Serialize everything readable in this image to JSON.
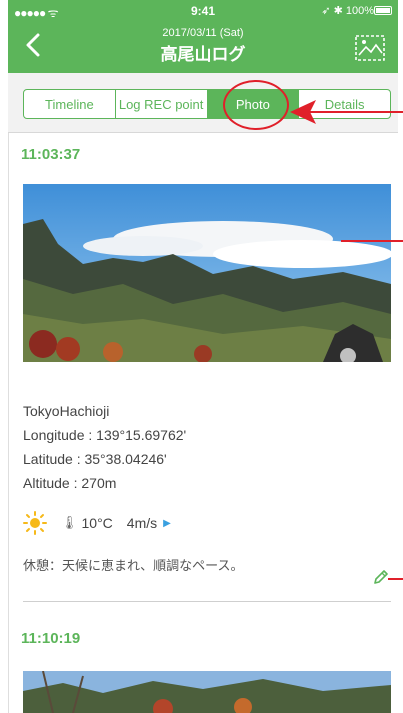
{
  "status_bar": {
    "signal": "●●●●● ᯤ",
    "time": "9:41",
    "right": "➶ ✱ 100%"
  },
  "nav": {
    "date": "2017/03/11 (Sat)",
    "title": "高尾山ログ"
  },
  "tabs": [
    {
      "label": "Timeline",
      "active": false
    },
    {
      "label": "Log REC point",
      "active": false
    },
    {
      "label": "Photo",
      "active": true
    },
    {
      "label": "Details",
      "active": false
    }
  ],
  "entries": [
    {
      "time": "11:03:37",
      "location": "TokyoHachioji",
      "longitude": "Longitude : 139°15.69762'",
      "latitude": "Latitude : 35°38.04246'",
      "altitude": "Altitude : 270m",
      "weather_icon": "sun-icon",
      "temperature": "10°C",
      "wind": "4m/s",
      "memo": "休憩：天候に恵まれ、順調なペース。"
    },
    {
      "time": "11:10:19"
    }
  ],
  "colors": {
    "accent": "#5cb55a",
    "annotation": "#e0202a"
  }
}
